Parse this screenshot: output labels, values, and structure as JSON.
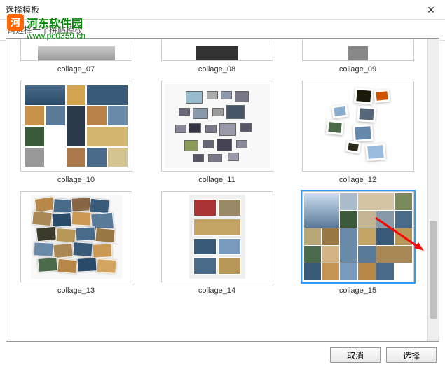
{
  "window": {
    "title": "选择模板",
    "subtitle": "请选择一个拼贴模板"
  },
  "watermark": {
    "brand": "河东软件园",
    "url": "www.pc0359.cn"
  },
  "templates": [
    {
      "label": "collage_07"
    },
    {
      "label": "collage_08"
    },
    {
      "label": "collage_09"
    },
    {
      "label": "collage_10"
    },
    {
      "label": "collage_11"
    },
    {
      "label": "collage_12"
    },
    {
      "label": "collage_13"
    },
    {
      "label": "collage_14"
    },
    {
      "label": "collage_15"
    }
  ],
  "buttons": {
    "cancel": "取消",
    "select": "选择"
  }
}
